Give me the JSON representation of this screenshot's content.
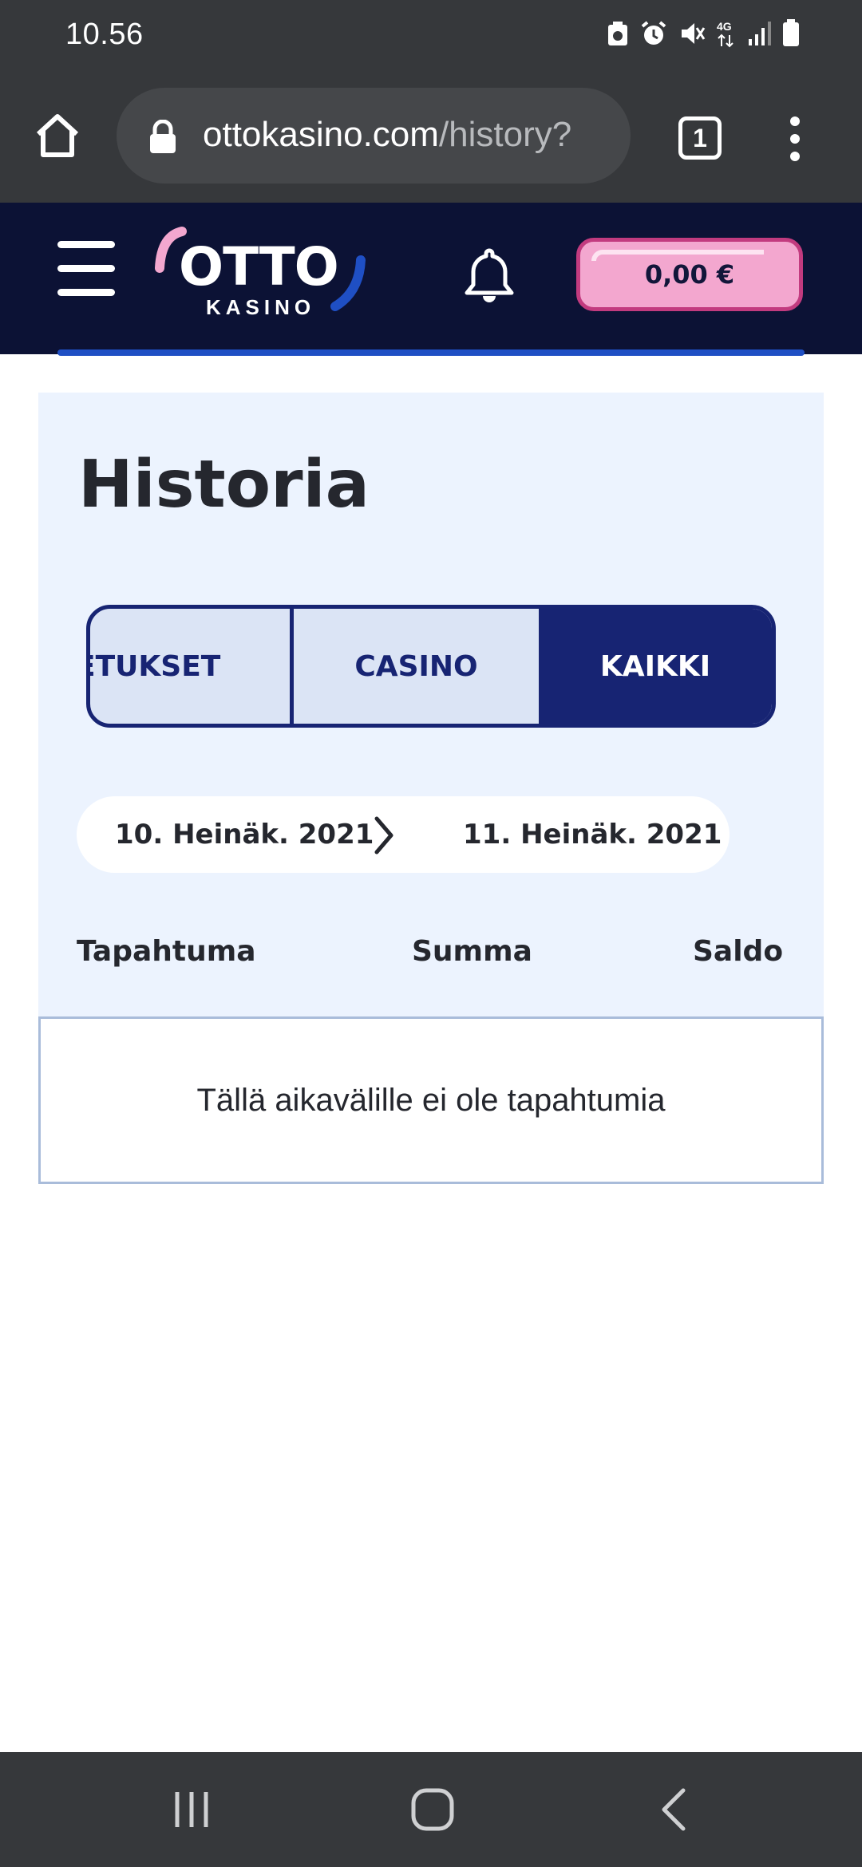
{
  "status_bar": {
    "time": "10.56",
    "network": "4G"
  },
  "browser": {
    "url_domain": "ottokasino.com",
    "url_path": "/history?",
    "tab_count": "1"
  },
  "site_header": {
    "logo_main": "OTTO",
    "logo_sub": "KASINO",
    "balance": "0,00 €",
    "brand_colors": {
      "navy": "#0c1235",
      "pink": "#f3a7cf",
      "blue": "#1f4fc4"
    }
  },
  "page": {
    "title": "Historia",
    "tabs": [
      {
        "label": "ETUKSET",
        "active": false
      },
      {
        "label": "CASINO",
        "active": false
      },
      {
        "label": "KAIKKI",
        "active": true
      }
    ],
    "date_from": "10. Heinäk. 2021",
    "date_to": "11. Heinäk. 2021",
    "columns": [
      "Tapahtuma",
      "Summa",
      "Saldo"
    ],
    "empty_message": "Tällä aikavälille ei ole tapahtumia"
  }
}
